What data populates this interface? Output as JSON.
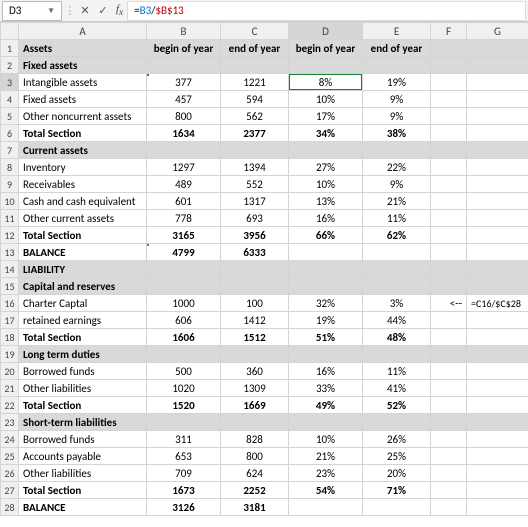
{
  "nameBox": "D3",
  "formulaBar": {
    "part1": "=",
    "part2": "B3",
    "op": "/",
    "part3": "$B$13"
  },
  "cols": [
    "A",
    "B",
    "C",
    "D",
    "E",
    "F",
    "G"
  ],
  "header": {
    "A": "Assets",
    "B": "begin of year",
    "C": "end of year",
    "D": "begin of year",
    "E": "end of year"
  },
  "rows": [
    {
      "n": 1,
      "A": "Assets",
      "B": "begin of year",
      "C": "end of year",
      "D": "begin of year",
      "E": "end of year",
      "hdr": true,
      "bold": true
    },
    {
      "n": 2,
      "A": "Fixed assets",
      "hdr": true,
      "bold": true
    },
    {
      "n": 3,
      "A": "Intangible assets",
      "B": "377",
      "C": "1221",
      "D": "8%",
      "E": "19%",
      "selB": "blue",
      "selD": "green"
    },
    {
      "n": 4,
      "A": "Fixed assets",
      "B": "457",
      "C": "594",
      "D": "10%",
      "E": "9%"
    },
    {
      "n": 5,
      "A": "Other noncurrent assets",
      "B": "800",
      "C": "562",
      "D": "17%",
      "E": "9%"
    },
    {
      "n": 6,
      "A": "Total Section",
      "B": "1634",
      "C": "2377",
      "D": "34%",
      "E": "38%",
      "bold": true
    },
    {
      "n": 7,
      "A": "Current assets",
      "hdr": true,
      "bold": true
    },
    {
      "n": 8,
      "A": "Inventory",
      "B": "1297",
      "C": "1394",
      "D": "27%",
      "E": "22%"
    },
    {
      "n": 9,
      "A": "Receivables",
      "B": "489",
      "C": "552",
      "D": "10%",
      "E": "9%"
    },
    {
      "n": 10,
      "A": "Cash and cash equivalent",
      "B": "601",
      "C": "1317",
      "D": "13%",
      "E": "21%"
    },
    {
      "n": 11,
      "A": "Other current assets",
      "B": "778",
      "C": "693",
      "D": "16%",
      "E": "11%"
    },
    {
      "n": 12,
      "A": "Total Section",
      "B": "3165",
      "C": "3956",
      "D": "66%",
      "E": "62%",
      "bold": true
    },
    {
      "n": 13,
      "A": "BALANCE",
      "B": "4799",
      "C": "6333",
      "bold": true,
      "selB": "red"
    },
    {
      "n": 14,
      "A": "LIABILITY",
      "hdr": true,
      "bold": true
    },
    {
      "n": 15,
      "A": "Capital and reserves",
      "hdr": true,
      "bold": true
    },
    {
      "n": 16,
      "A": "Charter Captal",
      "B": "1000",
      "C": "100",
      "D": "32%",
      "E": "3%",
      "F": "<--",
      "G": "=C16/$C$28"
    },
    {
      "n": 17,
      "A": "retained earnings",
      "B": "606",
      "C": "1412",
      "D": "19%",
      "E": "44%"
    },
    {
      "n": 18,
      "A": "Total Section",
      "B": "1606",
      "C": "1512",
      "D": "51%",
      "E": "48%",
      "bold": true
    },
    {
      "n": 19,
      "A": "Long term duties",
      "hdr": true,
      "bold": true
    },
    {
      "n": 20,
      "A": "Borrowed funds",
      "B": "500",
      "C": "360",
      "D": "16%",
      "E": "11%"
    },
    {
      "n": 21,
      "A": "Other liabilities",
      "B": "1020",
      "C": "1309",
      "D": "33%",
      "E": "41%"
    },
    {
      "n": 22,
      "A": "Total Section",
      "B": "1520",
      "C": "1669",
      "D": "49%",
      "E": "52%",
      "bold": true
    },
    {
      "n": 23,
      "A": "Short-term liabilities",
      "hdr": true,
      "bold": true
    },
    {
      "n": 24,
      "A": "Borrowed funds",
      "B": "311",
      "C": "828",
      "D": "10%",
      "E": "26%"
    },
    {
      "n": 25,
      "A": "Accounts payable",
      "B": "653",
      "C": "800",
      "D": "21%",
      "E": "25%"
    },
    {
      "n": 26,
      "A": "Other liabilities",
      "B": "709",
      "C": "624",
      "D": "23%",
      "E": "20%"
    },
    {
      "n": 27,
      "A": "Total Section",
      "B": "1673",
      "C": "2252",
      "D": "54%",
      "E": "71%",
      "bold": true
    },
    {
      "n": 28,
      "A": "BALANCE",
      "B": "3126",
      "C": "3181",
      "bold": true
    }
  ]
}
